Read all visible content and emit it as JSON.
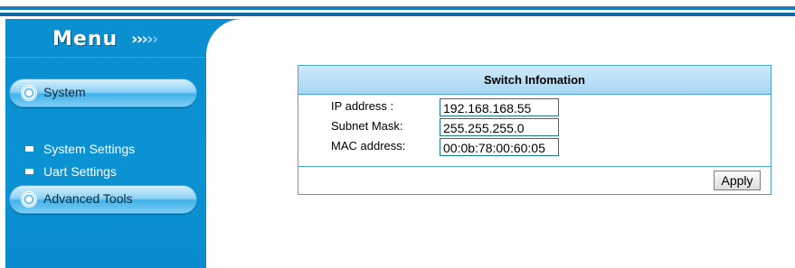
{
  "sidebar": {
    "title": "Menu",
    "title_arrows": [
      "›",
      "›",
      "›",
      "›",
      "›"
    ],
    "arrow_colors": [
      "#ffffff",
      "#ffffff",
      "#cfeefc",
      "#9fd9f5",
      "#6fc4ee"
    ],
    "sections": [
      {
        "label": "System",
        "icon": "radio-bullet-icon"
      },
      {
        "label": "Advanced Tools",
        "icon": "radio-bullet-icon"
      }
    ],
    "items": [
      {
        "label": "System Settings",
        "icon": "square-bullet-icon"
      },
      {
        "label": "Uart Settings",
        "icon": "square-bullet-icon"
      }
    ]
  },
  "panel": {
    "title": "Switch Infomation",
    "rows": [
      {
        "label": "IP address :",
        "value": "192.168.168.55"
      },
      {
        "label": "Subnet Mask:",
        "value": "255.255.255.0"
      },
      {
        "label": "MAC address:",
        "value": "00:0b:78:00:60:05"
      }
    ],
    "apply_label": "Apply"
  },
  "colors": {
    "sidebar_bg": "#0a8fd0",
    "panel_border": "#4aa6d6",
    "header_bg": "#a7d6f4"
  }
}
